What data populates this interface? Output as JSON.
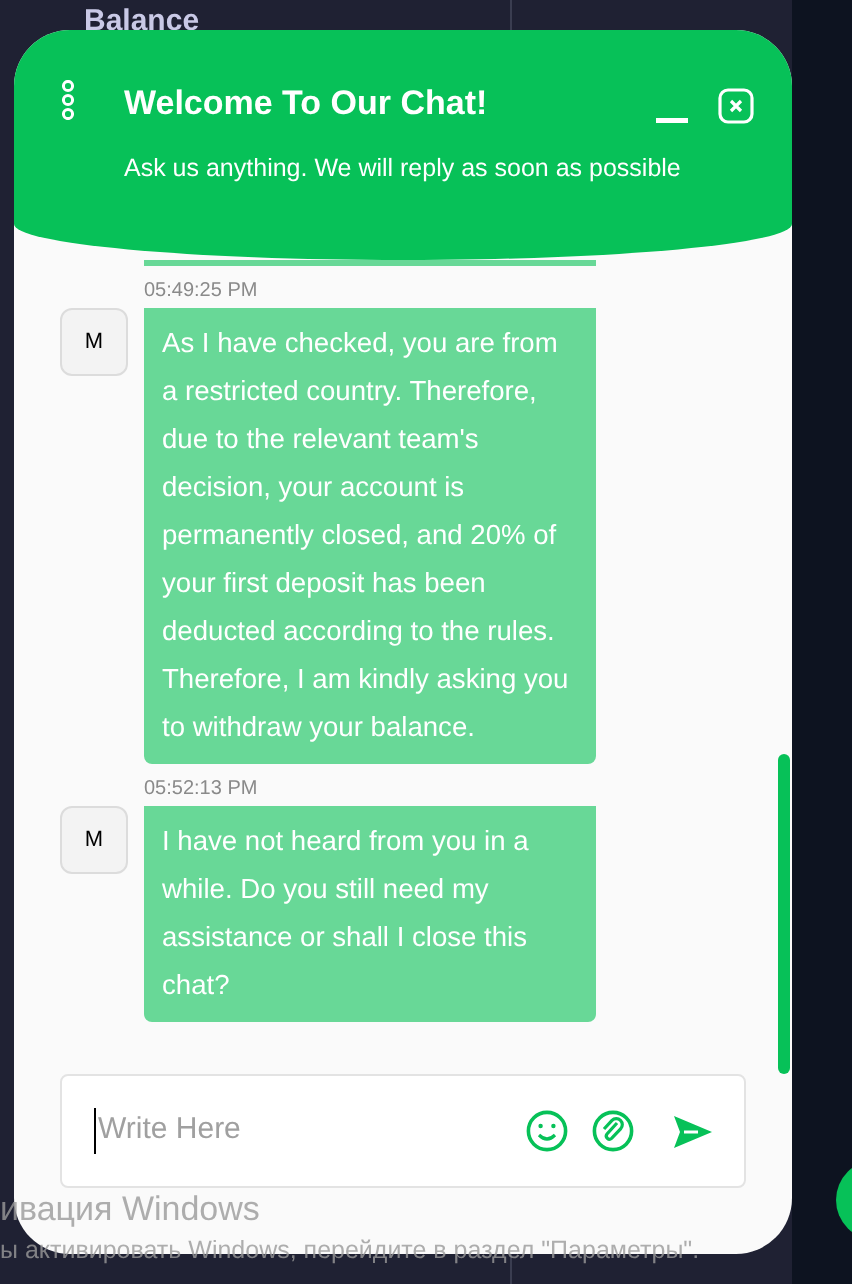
{
  "page": {
    "heading": "Balance"
  },
  "chat": {
    "title": "Welcome To Our Chat!",
    "subtitle": "Ask us anything. We will reply as soon as possible",
    "messages": [
      {
        "time": "05:49:25 PM",
        "avatar": "M",
        "text": "As I have checked, you are from a restricted country. Therefore, due to the relevant team's decision, your account is permanently closed, and 20% of your first deposit has been deducted according to the rules. Therefore, I am kindly asking you to withdraw your balance."
      },
      {
        "time": "05:52:13 PM",
        "avatar": "M",
        "text": "I have not heard from you in a while. Do you still need my assistance or shall I close this chat?"
      }
    ],
    "input": {
      "placeholder": "Write Here"
    }
  },
  "windows_notice": {
    "title": "ивация Windows",
    "text": "ы активировать Windows, перейдите в раздел \"Параметры\"."
  }
}
